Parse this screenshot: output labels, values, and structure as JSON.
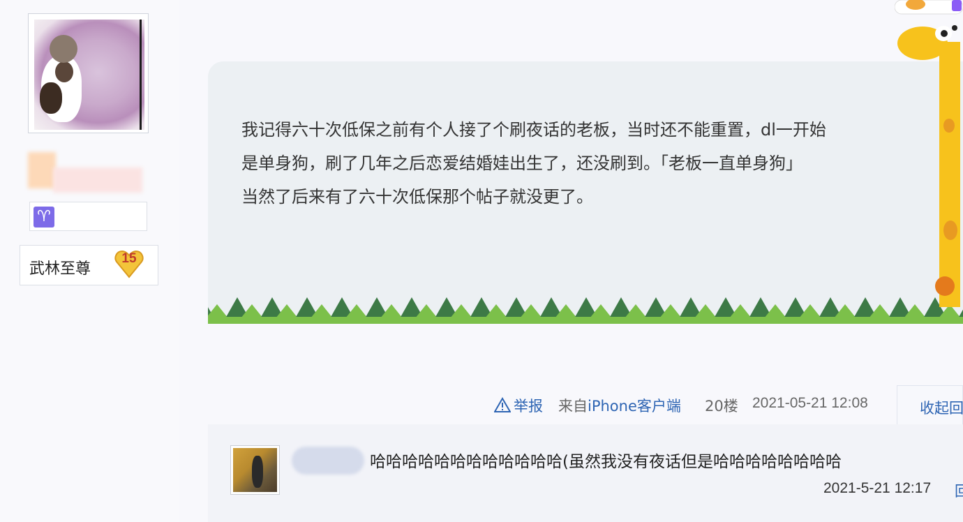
{
  "user": {
    "level_label": "武林至尊",
    "level_number": "15",
    "zodiac_symbol": "♈",
    "zodiac_icon": "aries-icon"
  },
  "post": {
    "lines": [
      "我记得六十次低保之前有个人接了个刷夜话的老板，当时还不能重置，dl一开始",
      "是单身狗，刷了几年之后恋爱结婚娃出生了，还没刷到。「老板一直单身狗」",
      "当然了后来有了六十次低保那个帖子就没更了。"
    ]
  },
  "meta": {
    "report_label": "举报",
    "source_prefix": "来自",
    "source_client": "iPhone客户端",
    "floor": "20楼",
    "datetime": "2021-05-21 12:08",
    "collapse_label": "收起回"
  },
  "reply": {
    "text": "哈哈哈哈哈哈哈哈哈哈哈哈(虽然我没有夜话但是哈哈哈哈哈哈哈哈",
    "time": "2021-5-21 12:17",
    "trailing": "回"
  },
  "colors": {
    "link": "#2d64b3",
    "bubble": "#ecf0f3",
    "grass_dark": "#3d7a46",
    "grass_light": "#7cc04a"
  }
}
